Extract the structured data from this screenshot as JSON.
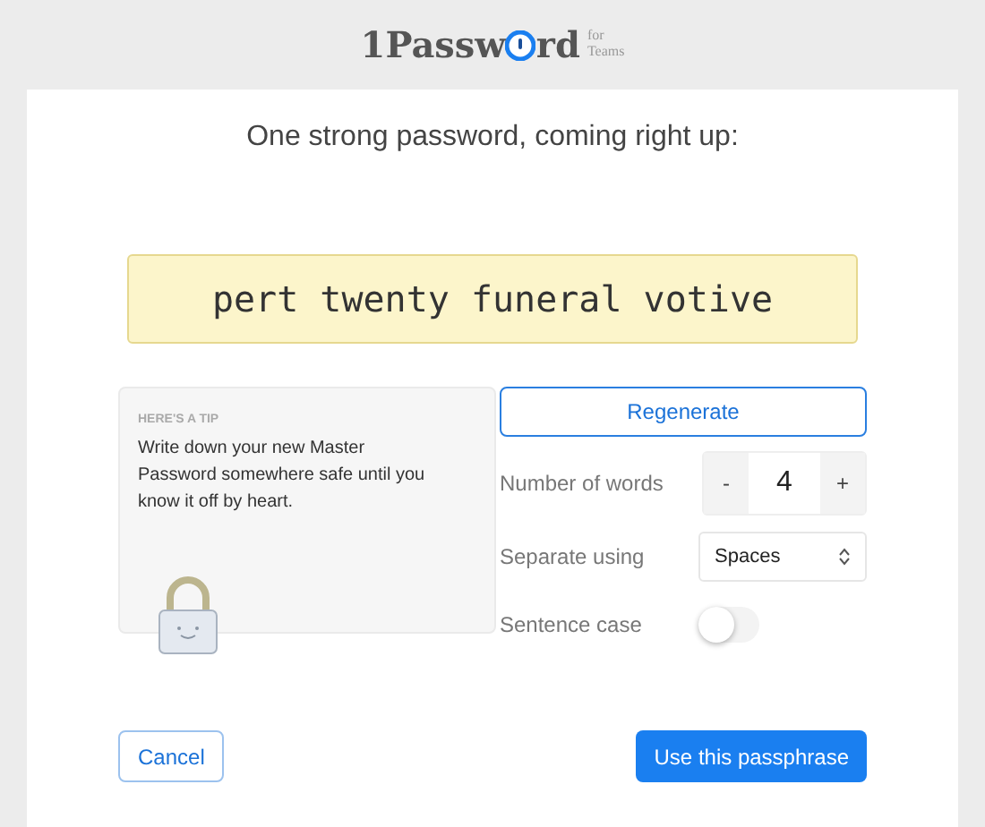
{
  "logo": {
    "parts": [
      "1Passw",
      "rd"
    ],
    "suffix": [
      "for",
      "Teams"
    ]
  },
  "heading": "One strong password, coming right up:",
  "password": "pert twenty funeral votive",
  "tip": {
    "label": "HERE'S A TIP",
    "text": "Write down your new Master Password somewhere safe until you know it off by heart."
  },
  "regenerate": "Regenerate",
  "options": [
    {
      "kind": "stepper",
      "label": "Number of words",
      "minus": "-",
      "value": "4",
      "plus": "+"
    },
    {
      "kind": "select",
      "label": "Separate using",
      "value": "Spaces"
    },
    {
      "kind": "toggle",
      "label": "Sentence case",
      "on": false
    }
  ],
  "buttons": {
    "cancel": "Cancel",
    "confirm": "Use this passphrase"
  }
}
